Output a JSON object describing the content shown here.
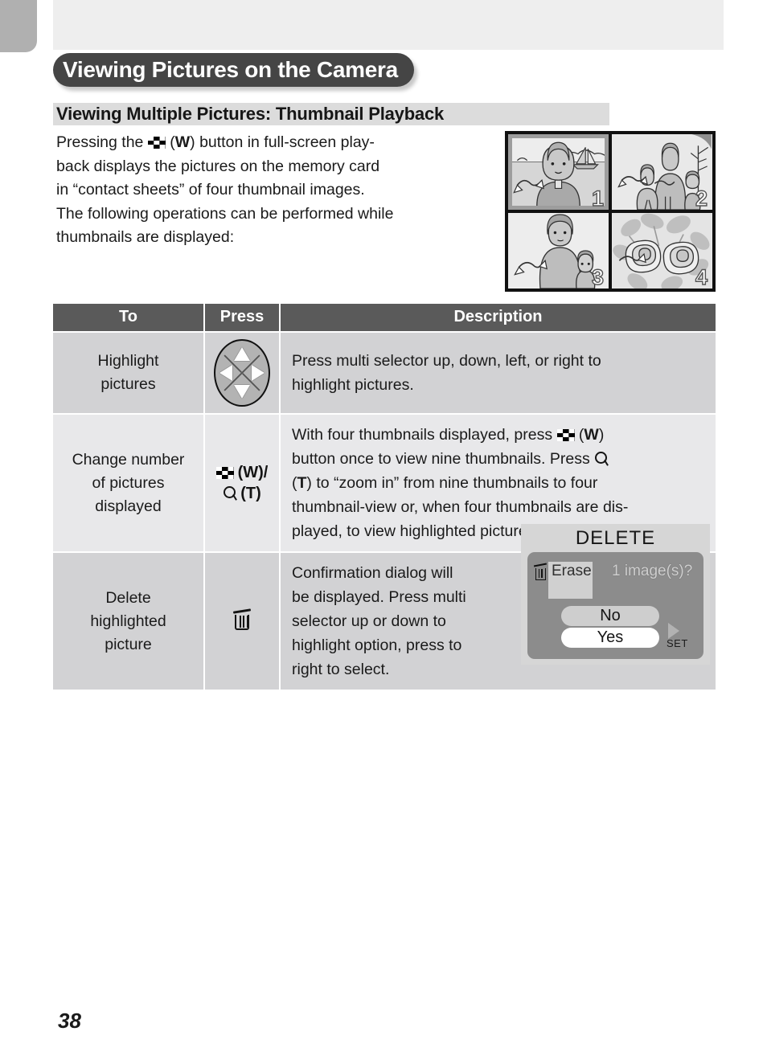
{
  "page": {
    "number": "38",
    "chapter_title": "Viewing Pictures on the Camera",
    "section_title": "Viewing Multiple Pictures: Thumbnail Playback"
  },
  "intro": {
    "line1_a": "Pressing  the",
    "line1_icon": "thumbnail-button-icon",
    "line1_b": "(",
    "line1_w": "W",
    "line1_c": ")  button  in  full-screen  play-",
    "line2": "back  displays  the  pictures  on  the  memory  card",
    "line3": "in  “contact  sheets”  of  four  thumbnail  images.",
    "line4": "The following operations can be performed while",
    "line5": "thumbnails are displayed:"
  },
  "thumbnail_preview": {
    "cells": [
      {
        "number": "1",
        "scene": "woman-with-sailboat-lake",
        "selected": true
      },
      {
        "number": "2",
        "scene": "woman-with-two-children",
        "selected": false
      },
      {
        "number": "3",
        "scene": "woman-with-child",
        "selected": false
      },
      {
        "number": "4",
        "scene": "roses-flowers",
        "selected": false
      }
    ]
  },
  "table": {
    "headers": {
      "to": "To",
      "press": "Press",
      "description": "Description"
    },
    "rows": [
      {
        "to_line1": "Highlight",
        "to_line2": "pictures",
        "press_icon": "multi-selector-icon",
        "desc_line1": "Press  multi  selector  up,  down,  left,  or  right  to",
        "desc_line2": "highlight pictures.",
        "desc_line3": "",
        "desc_line4": "",
        "desc_line5": ""
      },
      {
        "to_line1": "Change number",
        "to_line2": "of pictures",
        "to_line3": "displayed",
        "press_w_icon": "thumbnail-button-icon",
        "press_w_label": "(W)/",
        "press_t_icon": "zoom-magnifier-icon",
        "press_t_label": "(T)",
        "desc_line1_a": "With  four  thumbnails  displayed,  press",
        "desc_line1_b": "(",
        "desc_line1_w": "W",
        "desc_line1_c": ")",
        "desc_line2_a": "button  once  to  view  nine  thumbnails.    Press",
        "desc_line3_a": "(",
        "desc_line3_t": "T",
        "desc_line3_b": ")  to  “zoom  in”  from  nine  thumbnails  to  four",
        "desc_line4": "thumbnail-view or, when four thumbnails are dis-",
        "desc_line5": "played, to view highlighted picture full screen."
      },
      {
        "to_line1": "Delete",
        "to_line2": "highlighted",
        "to_line3": "picture",
        "press_icon": "trash-icon",
        "desc_line1": "Confirmation      dialog      will",
        "desc_line2": "be  displayed.    Press  multi",
        "desc_line3": "selector   up   or   down   to",
        "desc_line4": "highlight  option,  press  to",
        "desc_line5": "right to select."
      }
    ]
  },
  "delete_dialog": {
    "title": "DELETE",
    "trash_icon": "trash-icon",
    "erase_label": "Erase",
    "count_text": "1 image(s)?",
    "button_no": "No",
    "button_yes": "Yes",
    "set_label": "SET",
    "set_arrow_icon": "right-arrow-icon"
  }
}
